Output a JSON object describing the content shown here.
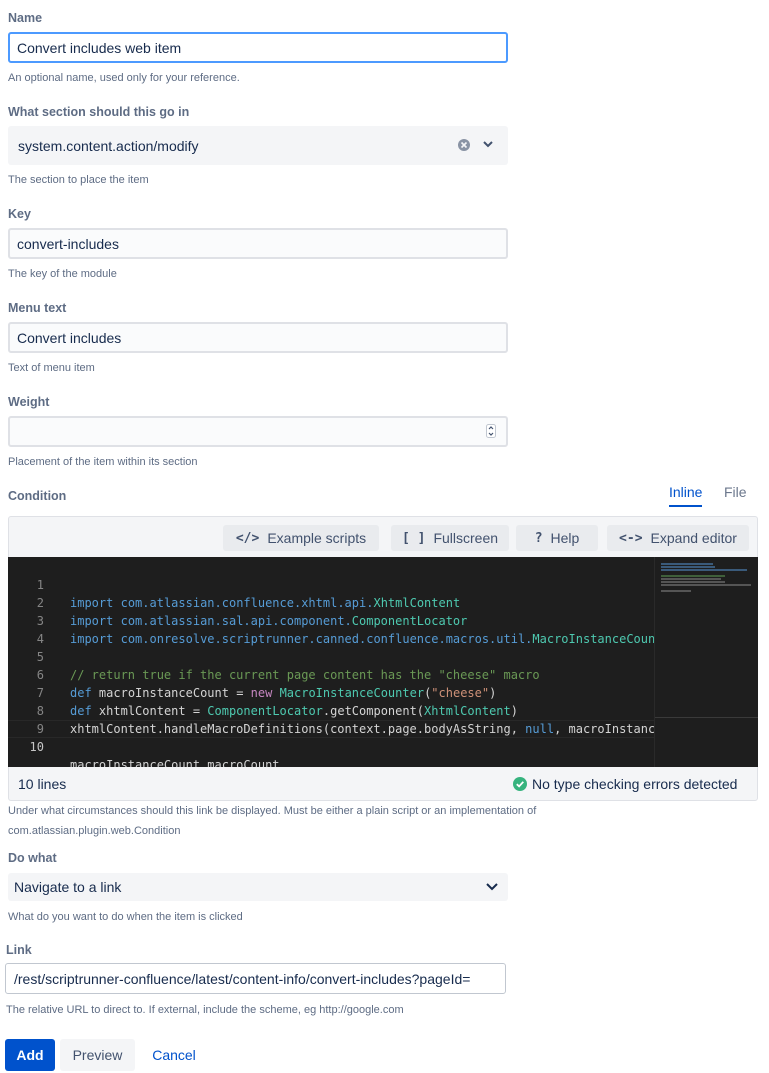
{
  "name": {
    "label": "Name",
    "value": "Convert includes web item",
    "help": "An optional name, used only for your reference."
  },
  "section": {
    "label": "What section should this go in",
    "value": "system.content.action/modify",
    "help": "The section to place the item"
  },
  "key": {
    "label": "Key",
    "value": "convert-includes",
    "help": "The key of the module"
  },
  "menu_text": {
    "label": "Menu text",
    "value": "Convert includes",
    "help": "Text of menu item"
  },
  "weight": {
    "label": "Weight",
    "value": "",
    "help": "Placement of the item within its section"
  },
  "condition": {
    "label": "Condition",
    "tabs": [
      "Inline",
      "File"
    ],
    "active_tab": "Inline",
    "toolbar": {
      "example_scripts": "Example scripts",
      "fullscreen": "Fullscreen",
      "help": "Help",
      "expand_editor": "Expand editor"
    },
    "code_lines": [
      {
        "n": "1",
        "text": "import com.atlassian.confluence.xhtml.api.XhtmlContent"
      },
      {
        "n": "2",
        "text": "import com.atlassian.sal.api.component.ComponentLocator"
      },
      {
        "n": "3",
        "text": "import com.onresolve.scriptrunner.canned.confluence.macros.util.MacroInstanceCoun"
      },
      {
        "n": "4",
        "text": ""
      },
      {
        "n": "5",
        "text": "// return true if the current page content has the \"cheese\" macro"
      },
      {
        "n": "6",
        "text": "def macroInstanceCount = new MacroInstanceCounter(\"cheese\")"
      },
      {
        "n": "7",
        "text": "def xhtmlContent = ComponentLocator.getComponent(XhtmlContent)"
      },
      {
        "n": "8",
        "text": "xhtmlContent.handleMacroDefinitions(context.page.bodyAsString, null, macroInstanc"
      },
      {
        "n": "9",
        "text": ""
      },
      {
        "n": "10",
        "text": "macroInstanceCount.macroCount"
      }
    ],
    "status_lines": "10 lines",
    "status_check": "No type checking errors detected",
    "help_line1": "Under what circumstances should this link be displayed. Must be either a plain script or an implementation of",
    "help_line2": "com.atlassian.plugin.web.Condition"
  },
  "do_what": {
    "label": "Do what",
    "value": "Navigate to a link",
    "help": "What do you want to do when the item is clicked"
  },
  "link": {
    "label": "Link",
    "value": "/rest/scriptrunner-confluence/latest/content-info/convert-includes?pageId=",
    "help": "The relative URL to direct to. If external, include the scheme, eg http://google.com"
  },
  "actions": {
    "add": "Add",
    "preview": "Preview",
    "cancel": "Cancel"
  },
  "colors": {
    "primary": "#0052cc",
    "focus": "#4c9aff",
    "success": "#36b37e",
    "editor_bg": "#1e1e1e"
  }
}
